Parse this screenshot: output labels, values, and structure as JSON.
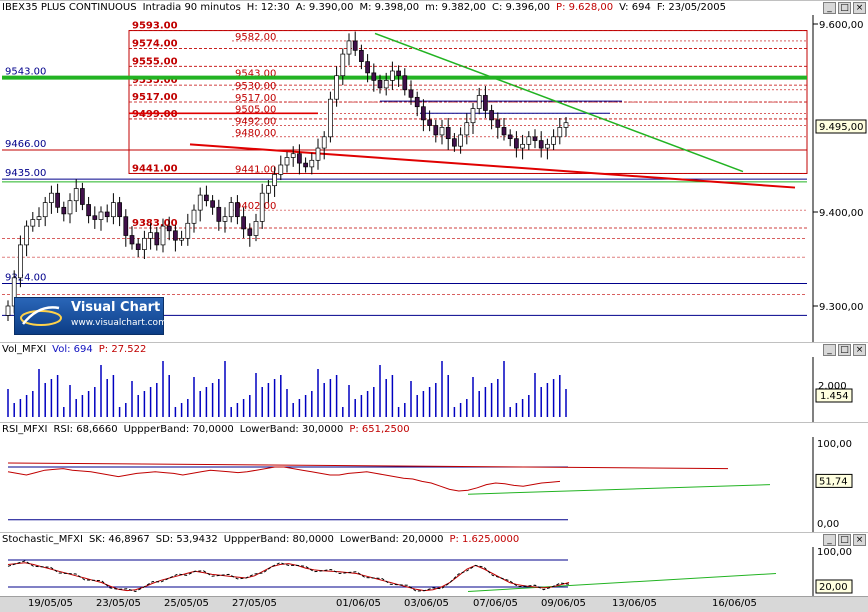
{
  "main_panel": {
    "symbol": "IBEX35 PLUS CONTINUOUS",
    "interval": "Intradia 90 minutos",
    "h": "H: 12:30",
    "a": "A: 9.390,00",
    "max": "M: 9.398,00",
    "min": "m: 9.382,00",
    "c": "C: 9.396,00",
    "p": "P: 9.628,00",
    "v": "V: 694",
    "f": "F: 23/05/2005",
    "price_box": "9.495,00",
    "price_axis": [
      "9.600,00",
      "9.400,00",
      "9.300,00"
    ],
    "levels_left": [
      "9543.00",
      "9466.00",
      "9435.00",
      "9324.00"
    ],
    "levels_red": [
      "9593.00",
      "9574.00",
      "9555.00",
      "9535.00",
      "9517.00",
      "9499.00",
      "9441.00",
      "9383.00"
    ],
    "levels_inner": [
      "9582.00",
      "9543.00",
      "9530.00",
      "9517.00",
      "9505.00",
      "9492.00",
      "9480.00",
      "9441.00",
      "9402.00"
    ]
  },
  "logo": {
    "title": "Visual Chart",
    "url": "www.visualchart.com"
  },
  "volume_panel": {
    "name": "Vol_MFXI",
    "vol": "Vol: 694",
    "p": "P: 27.522",
    "axis_label": "2.000",
    "value_box": "1.454"
  },
  "rsi_panel": {
    "name": "RSI_MFXI",
    "rsi": "RSI: 68,6660",
    "upper": "UppperBand: 70,0000",
    "lower": "LowerBand: 30,0000",
    "p": "P: 651,2500",
    "axis": [
      "100,00",
      "0,00"
    ],
    "value_box": "51,74"
  },
  "stoch_panel": {
    "name": "Stochastic_MFXI",
    "sk": "SK: 46,8967",
    "sd": "SD: 53,9432",
    "upper": "UppperBand: 80,0000",
    "lower": "LowerBand: 20,0000",
    "p": "P: 1.625,0000",
    "axis": [
      "100,00"
    ],
    "value_box": "20,00"
  },
  "x_axis": [
    "19/05/05",
    "23/05/05",
    "25/05/05",
    "27/05/05",
    "01/06/05",
    "03/06/05",
    "07/06/05",
    "09/06/05",
    "13/06/05",
    "16/06/05"
  ],
  "colors": {
    "bull": "#ffffff",
    "bear": "#40104a",
    "green": "#22b322",
    "red": "#e00000",
    "blue": "#00008b"
  }
}
